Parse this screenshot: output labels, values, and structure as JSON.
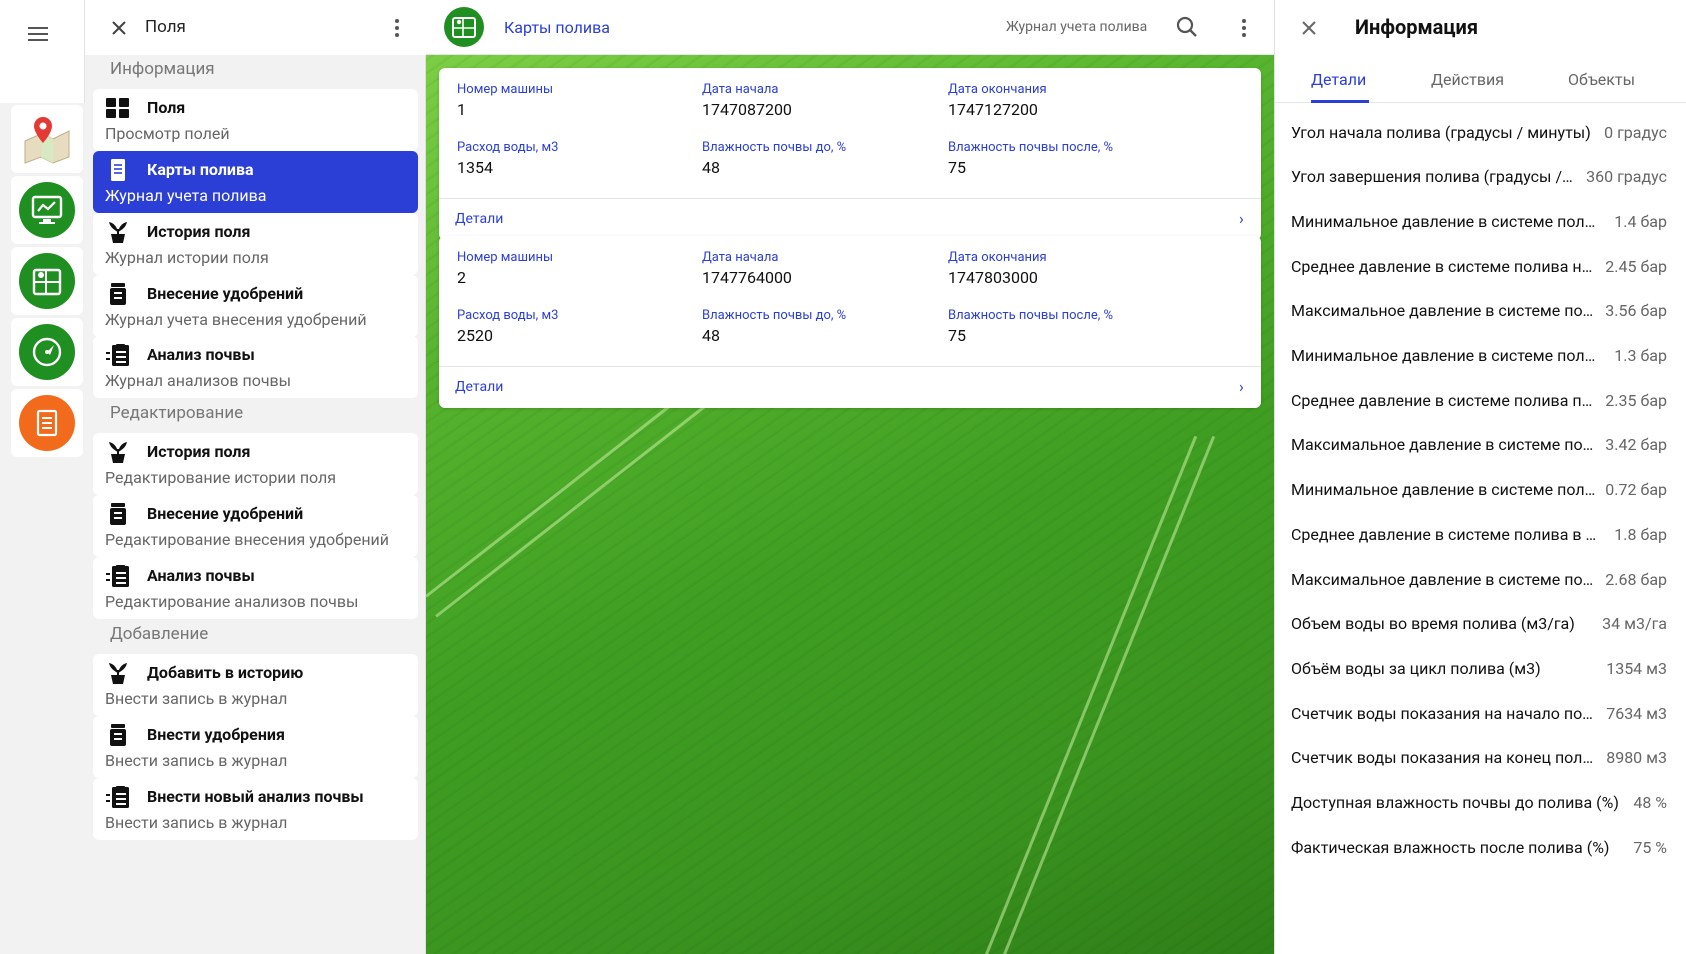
{
  "nav": {
    "title": "Поля",
    "sections": {
      "info": "Информация",
      "edit": "Редактирование",
      "add": "Добавление"
    },
    "items": [
      {
        "title": "Поля",
        "subtitle": "Просмотр полей"
      },
      {
        "title": "Карты полива",
        "subtitle": "Журнал учета полива"
      },
      {
        "title": "История поля",
        "subtitle": "Журнал истории поля"
      },
      {
        "title": "Внесение удобрений",
        "subtitle": "Журнал учета внесения удобрений"
      },
      {
        "title": "Анализ почвы",
        "subtitle": "Журнал анализов почвы"
      },
      {
        "title": "История поля",
        "subtitle": "Редактирование истории поля"
      },
      {
        "title": "Внесение удобрений",
        "subtitle": "Редактирование внесения удобрений"
      },
      {
        "title": "Анализ почвы",
        "subtitle": "Редактирование анализов почвы"
      },
      {
        "title": "Добавить в историю",
        "subtitle": "Внести запись в журнал"
      },
      {
        "title": "Внести удобрения",
        "subtitle": "Внести запись в журнал"
      },
      {
        "title": "Внести новый анализ почвы",
        "subtitle": "Внести запись в журнал"
      }
    ]
  },
  "main": {
    "title": "Карты полива",
    "journal_link": "Журнал учета полива",
    "cards": [
      {
        "machine_label": "Номер машины",
        "machine": "1",
        "start_label": "Дата начала",
        "start": "1747087200",
        "end_label": "Дата окончания",
        "end": "1747127200",
        "water_label": "Расход воды, м3",
        "water": "1354",
        "hum_before_label": "Влажность почвы до, %",
        "hum_before": "48",
        "hum_after_label": "Влажность почвы после, %",
        "hum_after": "75",
        "details": "Детали",
        "chevron": "›"
      },
      {
        "machine_label": "Номер машины",
        "machine": "2",
        "start_label": "Дата начала",
        "start": "1747764000",
        "end_label": "Дата окончания",
        "end": "1747803000",
        "water_label": "Расход воды, м3",
        "water": "2520",
        "hum_before_label": "Влажность почвы до, %",
        "hum_before": "48",
        "hum_after_label": "Влажность почвы после, %",
        "hum_after": "75",
        "details": "Детали",
        "chevron": "›"
      }
    ]
  },
  "info": {
    "title": "Информация",
    "tabs": [
      "Детали",
      "Действия",
      "Объекты"
    ],
    "props": [
      {
        "label": "Угол начала полива (градусы / минуты)",
        "value": "0 градус"
      },
      {
        "label": "Угол завершения полива (градусы / минуты)",
        "value": "360 градус"
      },
      {
        "label": "Минимальное давление в системе полива на начало",
        "value": "1.4 бар"
      },
      {
        "label": "Среднее давление в системе полива на начало",
        "value": "2.45 бар"
      },
      {
        "label": "Максимальное давление в системе полива на начало",
        "value": "3.56 бар"
      },
      {
        "label": "Минимальное давление в системе полива посередине",
        "value": "1.3 бар"
      },
      {
        "label": "Среднее давление в системе полива посередине",
        "value": "2.35 бар"
      },
      {
        "label": "Максимальное давление в системе полива посередине",
        "value": "3.42 бар"
      },
      {
        "label": "Минимальное давление в системе полива в конце",
        "value": "0.72 бар"
      },
      {
        "label": "Среднее давление в системе полива в конце",
        "value": "1.8 бар"
      },
      {
        "label": "Максимальное давление в системе полива в конце",
        "value": "2.68 бар"
      },
      {
        "label": "Объем воды во время полива (м3/га)",
        "value": "34 м3/га"
      },
      {
        "label": "Объём воды за цикл полива (м3)",
        "value": "1354 м3"
      },
      {
        "label": "Счетчик воды показания на начало полива",
        "value": "7634 м3"
      },
      {
        "label": "Счетчик воды показания на конец полива",
        "value": "8980 м3"
      },
      {
        "label": "Доступная влажность почвы до полива (%)",
        "value": "48 %"
      },
      {
        "label": "Фактическая влажность после полива (%)",
        "value": "75 %"
      }
    ]
  },
  "colors": {
    "accent": "#2b3fd6",
    "green": "#1f8f22",
    "orange": "#f26a1b"
  }
}
